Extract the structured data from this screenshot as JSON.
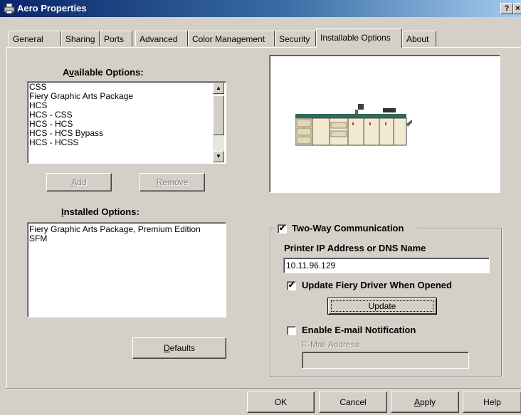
{
  "window": {
    "title": "Aero Properties",
    "help_button": "?",
    "close_button": "×"
  },
  "tabs": [
    {
      "label": "General"
    },
    {
      "label": "Sharing"
    },
    {
      "label": "Ports"
    },
    {
      "label": "Advanced"
    },
    {
      "label": "Color Management"
    },
    {
      "label": "Security"
    },
    {
      "label": "Installable Options",
      "active": true
    },
    {
      "label": "About"
    }
  ],
  "available": {
    "label_pre": "A",
    "label_u": "v",
    "label_post": "ailable Options:",
    "items": [
      "CSS",
      "Fiery Graphic Arts Package",
      "HCS",
      "HCS - CSS",
      "HCS - HCS",
      "HCS - HCS Bypass",
      "HCS - HCSS"
    ],
    "add_pre": "",
    "add_u": "A",
    "add_post": "dd",
    "remove_pre": "",
    "remove_u": "R",
    "remove_post": "emove"
  },
  "installed": {
    "label_pre": "",
    "label_u": "I",
    "label_post": "nstalled Options:",
    "items": [
      "Fiery Graphic Arts Package, Premium Edition",
      "SFM"
    ],
    "defaults_pre": "",
    "defaults_u": "D",
    "defaults_post": "efaults"
  },
  "comm": {
    "two_way_label": "Two-Way Communication",
    "two_way_checked": true,
    "ip_label": "Printer IP Address or DNS Name",
    "ip_value": "10.11.96.129",
    "update_driver_label": "Update Fiery Driver When Opened",
    "update_driver_checked": true,
    "update_button": "Update",
    "email_label": "Enable E-mail Notification",
    "email_checked": false,
    "email_address_label": "E-Mail Address",
    "email_address_value": ""
  },
  "footer": {
    "ok": "OK",
    "cancel": "Cancel",
    "apply_pre": "",
    "apply_u": "A",
    "apply_post": "pply",
    "help": "Help"
  },
  "colors": {
    "title_start": "#0a246a",
    "title_end": "#a6caf0",
    "face": "#d4d0c8"
  }
}
